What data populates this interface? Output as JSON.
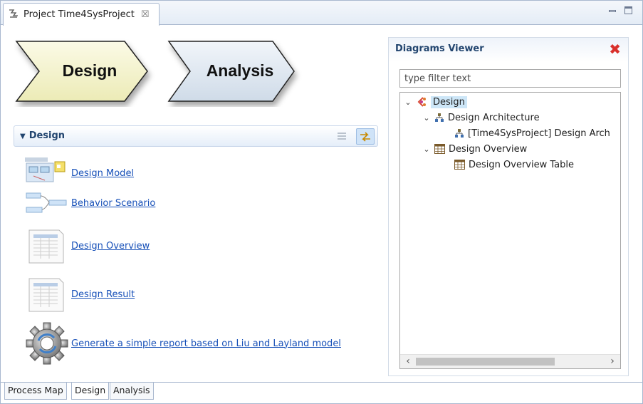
{
  "window": {
    "tab_title": "Project Time4SysProject",
    "tab_close": "☒",
    "icons": {
      "tab": "project-icon",
      "minimize": "minimize-icon",
      "maximize": "maximize-icon"
    }
  },
  "process_map": {
    "steps": [
      {
        "label": "Design",
        "fill": "#f6f4c9"
      },
      {
        "label": "Analysis",
        "fill": "#dfe8f2"
      }
    ]
  },
  "design_section": {
    "title": "Design",
    "entries": [
      {
        "label": "Design Model",
        "icon": "design-model-thumbnail"
      },
      {
        "label": "Behavior Scenario",
        "icon": "behavior-scenario-thumbnail"
      },
      {
        "label": "Design Overview",
        "icon": "table-sheet-icon"
      },
      {
        "label": "Design Result",
        "icon": "table-sheet-icon"
      },
      {
        "label": "Generate a simple report based on Liu and Layland model",
        "icon": "gear-report-icon"
      }
    ]
  },
  "diagrams_viewer": {
    "title": "Diagrams Viewer",
    "filter_placeholder": "type filter text",
    "tree": [
      {
        "label": "Design",
        "icon": "design-viewpoint-icon",
        "expanded": true,
        "selected": true
      },
      {
        "label": "Design Architecture",
        "icon": "architecture-icon",
        "expanded": true
      },
      {
        "label": "[Time4SysProject] Design Arch",
        "icon": "architecture-icon"
      },
      {
        "label": "Design Overview",
        "icon": "table-icon",
        "expanded": true
      },
      {
        "label": "Design Overview Table",
        "icon": "table-icon"
      }
    ],
    "scroll_left": "‹",
    "scroll_right": "›"
  },
  "bottom_tabs": [
    {
      "label": "Process Map",
      "active": false
    },
    {
      "label": "Design",
      "active": true
    },
    {
      "label": "Analysis",
      "active": false
    }
  ],
  "colors": {
    "link": "#1750b8",
    "section_title": "#22456f",
    "close_red": "#d9302b"
  }
}
